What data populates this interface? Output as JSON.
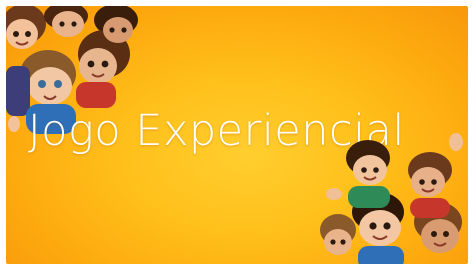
{
  "slide": {
    "title": "Jogo Experiencial",
    "background_color": "#ffb90f",
    "title_color": "#ffffff"
  },
  "illustrations": {
    "top_left": "cartoon-children-group-illustration",
    "bottom_right": "cartoon-children-group-illustration"
  }
}
